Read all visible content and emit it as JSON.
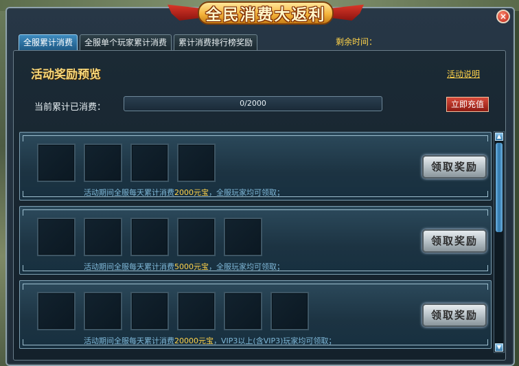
{
  "title": "全民消费大返利",
  "close_icon": "×",
  "tabs": [
    {
      "label": "全服累计消费",
      "active": true
    },
    {
      "label": "全服单个玩家累计消费",
      "active": false
    },
    {
      "label": "累计消费排行榜奖励",
      "active": false
    }
  ],
  "remaining": {
    "label": "剩余时间：",
    "value": ""
  },
  "section_title": "活动奖励预览",
  "help_link": "活动说明",
  "spent": {
    "label": "当前累计已消费：",
    "progress_text": "0/2000",
    "progress_fraction": 0
  },
  "recharge_button": "立即充值",
  "rows": [
    {
      "slots": 4,
      "desc_before": "活动期间全服每天累计消费",
      "amount": "2000元宝",
      "desc_after": "，全服玩家均可领取；",
      "claim": "领取奖励"
    },
    {
      "slots": 5,
      "desc_before": "活动期间全服每天累计消费",
      "amount": "5000元宝",
      "desc_after": "，全服玩家均可领取；",
      "claim": "领取奖励"
    },
    {
      "slots": 6,
      "desc_before": "活动期间全服每天累计消费",
      "amount": "20000元宝",
      "desc_after": "，VIP3以上(含VIP3)玩家均可领取；",
      "claim": "领取奖励"
    }
  ],
  "scroll_up_icon": "▲",
  "scroll_down_icon": "▼"
}
